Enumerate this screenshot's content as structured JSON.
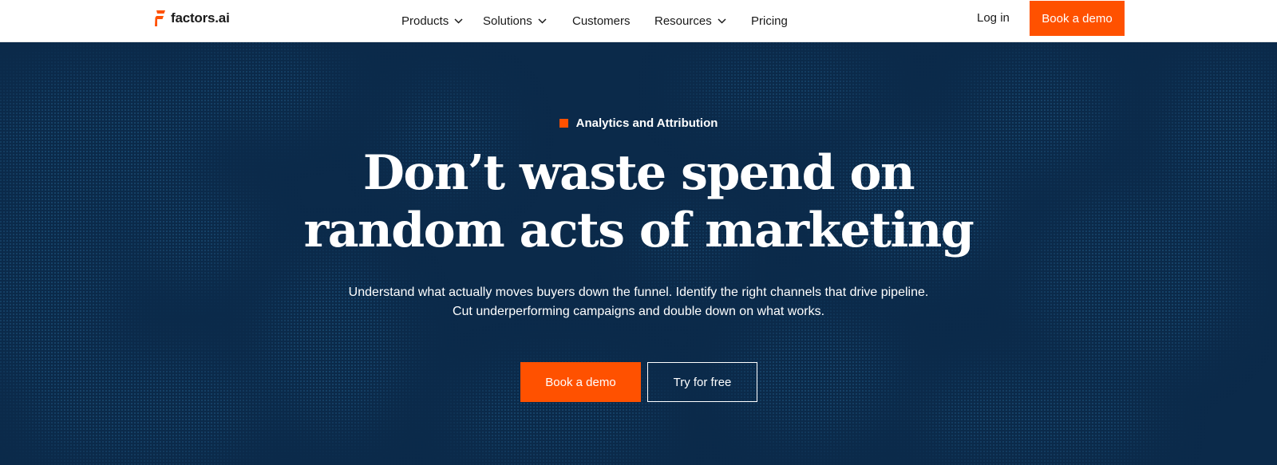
{
  "brand": {
    "name": "factors.ai",
    "accent_color": "#ff5100",
    "hero_background": "#0b2a4a"
  },
  "nav": {
    "items": [
      {
        "label": "Products",
        "has_dropdown": true
      },
      {
        "label": "Solutions",
        "has_dropdown": true
      },
      {
        "label": "Customers",
        "has_dropdown": false
      },
      {
        "label": "Resources",
        "has_dropdown": true
      },
      {
        "label": "Pricing",
        "has_dropdown": false
      }
    ],
    "login_label": "Log in",
    "demo_label": "Book a demo"
  },
  "hero": {
    "eyebrow": "Analytics and Attribution",
    "headline_line1": "Don’t waste spend on",
    "headline_line2": "random acts of marketing",
    "sub_line1": "Understand what actually moves buyers down the funnel. Identify the right channels that drive pipeline.",
    "sub_line2": "Cut underperforming campaigns and double down on what works.",
    "primary_cta": "Book a demo",
    "secondary_cta": "Try for free"
  },
  "icons": {
    "logo": "factors-logo-icon",
    "dropdown": "chevron-down-icon"
  }
}
